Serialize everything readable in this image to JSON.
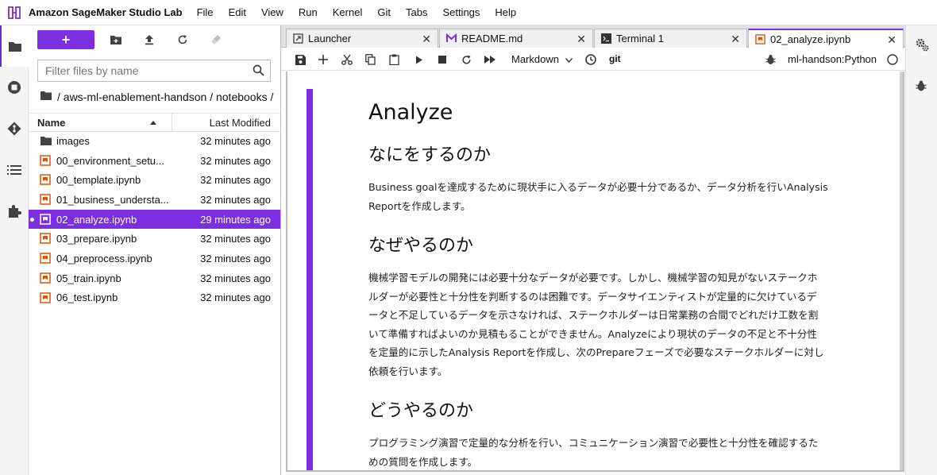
{
  "app": {
    "title": "Amazon SageMaker Studio Lab",
    "menus": [
      "File",
      "Edit",
      "View",
      "Run",
      "Kernel",
      "Git",
      "Tabs",
      "Settings",
      "Help"
    ]
  },
  "activity": {
    "icons": [
      "folder-icon",
      "running-icon",
      "git-icon",
      "toc-icon",
      "extension-icon"
    ]
  },
  "filebrowser": {
    "new_label": "+",
    "filter_placeholder": "Filter files by name",
    "breadcrumb": "/ aws-ml-enablement-handson / notebooks /",
    "header_name": "Name",
    "header_modified": "Last Modified",
    "items": [
      {
        "name": "images",
        "modified": "32 minutes ago",
        "type": "folder",
        "selected": false
      },
      {
        "name": "00_environment_setu...",
        "modified": "32 minutes ago",
        "type": "notebook",
        "selected": false
      },
      {
        "name": "00_template.ipynb",
        "modified": "32 minutes ago",
        "type": "notebook",
        "selected": false
      },
      {
        "name": "01_business_understa...",
        "modified": "32 minutes ago",
        "type": "notebook",
        "selected": false
      },
      {
        "name": "02_analyze.ipynb",
        "modified": "29 minutes ago",
        "type": "notebook",
        "selected": true
      },
      {
        "name": "03_prepare.ipynb",
        "modified": "32 minutes ago",
        "type": "notebook",
        "selected": false
      },
      {
        "name": "04_preprocess.ipynb",
        "modified": "32 minutes ago",
        "type": "notebook",
        "selected": false
      },
      {
        "name": "05_train.ipynb",
        "modified": "32 minutes ago",
        "type": "notebook",
        "selected": false
      },
      {
        "name": "06_test.ipynb",
        "modified": "32 minutes ago",
        "type": "notebook",
        "selected": false
      }
    ]
  },
  "tabs": [
    {
      "label": "Launcher",
      "icon": "launcher-icon",
      "active": false
    },
    {
      "label": "README.md",
      "icon": "markdown-icon",
      "active": false
    },
    {
      "label": "Terminal 1",
      "icon": "terminal-icon",
      "active": false
    },
    {
      "label": "02_analyze.ipynb",
      "icon": "notebook-icon",
      "active": true
    }
  ],
  "notebook_toolbar": {
    "cell_type": "Markdown",
    "git_label": "git",
    "kernel": "ml-handson:Python"
  },
  "notebook": {
    "title": "Analyze",
    "sections": [
      {
        "heading": "なにをするのか",
        "lines": [
          "Business goalを達成するために現状手に入るデータが必要十分であるか、データ分析を行いAnalysis",
          "Reportを作成します。"
        ]
      },
      {
        "heading": "なぜやるのか",
        "lines": [
          "機械学習モデルの開発には必要十分なデータが必要です。しかし、機械学習の知見がないステークホ",
          "ルダーが必要性と十分性を判断するのは困難です。データサイエンティストが定量的に欠けているデ",
          "ータと不足しているデータを示さなければ、ステークホルダーは日常業務の合間でどれだけ工数を割",
          "いて準備すればよいのか見積もることができません。Analyzeにより現状のデータの不足と不十分性",
          "を定量的に示したAnalysis Reportを作成し、次のPrepareフェーズで必要なステークホルダーに対し",
          "依頼を行います。"
        ]
      },
      {
        "heading": "どうやるのか",
        "lines": [
          "プログラミング演習で定量的な分析を行い、コミュニケーション演習で必要性と十分性を確認するた",
          "めの質問を作成します。"
        ]
      }
    ]
  },
  "colors": {
    "accent": "#7b2fe0",
    "notebook_icon": "#e65100"
  }
}
